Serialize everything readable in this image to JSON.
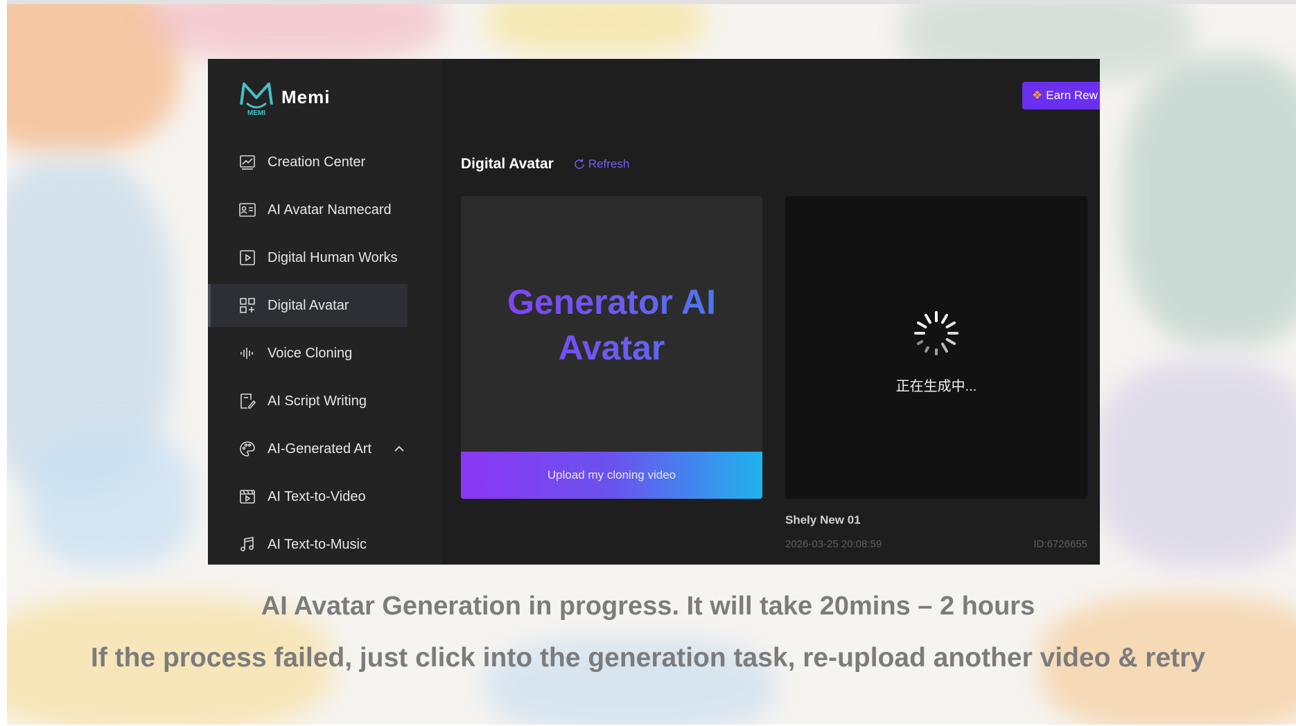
{
  "app": {
    "logo_name": "Memi",
    "logo_small": "MEMI",
    "earn_label": "Earn Rew"
  },
  "sidebar": {
    "items": [
      {
        "label": "Creation Center",
        "icon": "chart-icon"
      },
      {
        "label": "AI Avatar Namecard",
        "icon": "id-card-icon"
      },
      {
        "label": "Digital Human Works",
        "icon": "play-box-icon"
      },
      {
        "label": "Digital Avatar",
        "icon": "avatar-grid-icon",
        "active": true
      },
      {
        "label": "Voice Cloning",
        "icon": "waveform-icon"
      },
      {
        "label": "AI Script Writing",
        "icon": "script-pen-icon"
      },
      {
        "label": "AI-Generated Art",
        "icon": "palette-icon",
        "expanded": true
      },
      {
        "label": "AI Text-to-Video",
        "icon": "video-icon"
      },
      {
        "label": "AI Text-to-Music",
        "icon": "music-note-icon"
      }
    ]
  },
  "main": {
    "section_title": "Digital Avatar",
    "refresh_label": "Refresh",
    "generator_card": {
      "title_line1": "Generator AI",
      "title_line2": "Avatar",
      "upload_label": "Upload my cloning video"
    },
    "task_card": {
      "status": "正在生成中...",
      "name": "Shely New 01",
      "date": "2026-03-25 20:08:59",
      "id": "ID:6726655"
    }
  },
  "captions": {
    "line1": "AI Avatar Generation in progress. It will take 20mins – 2 hours",
    "line2": "If the process failed, just click into the generation task, re-upload another video & retry"
  },
  "colors": {
    "accent_purple": "#6b2ff0",
    "gradient_start": "#8b37f3",
    "gradient_end": "#1fb3ee",
    "app_bg": "#1e1e1e",
    "sidebar_bg": "#232323"
  }
}
